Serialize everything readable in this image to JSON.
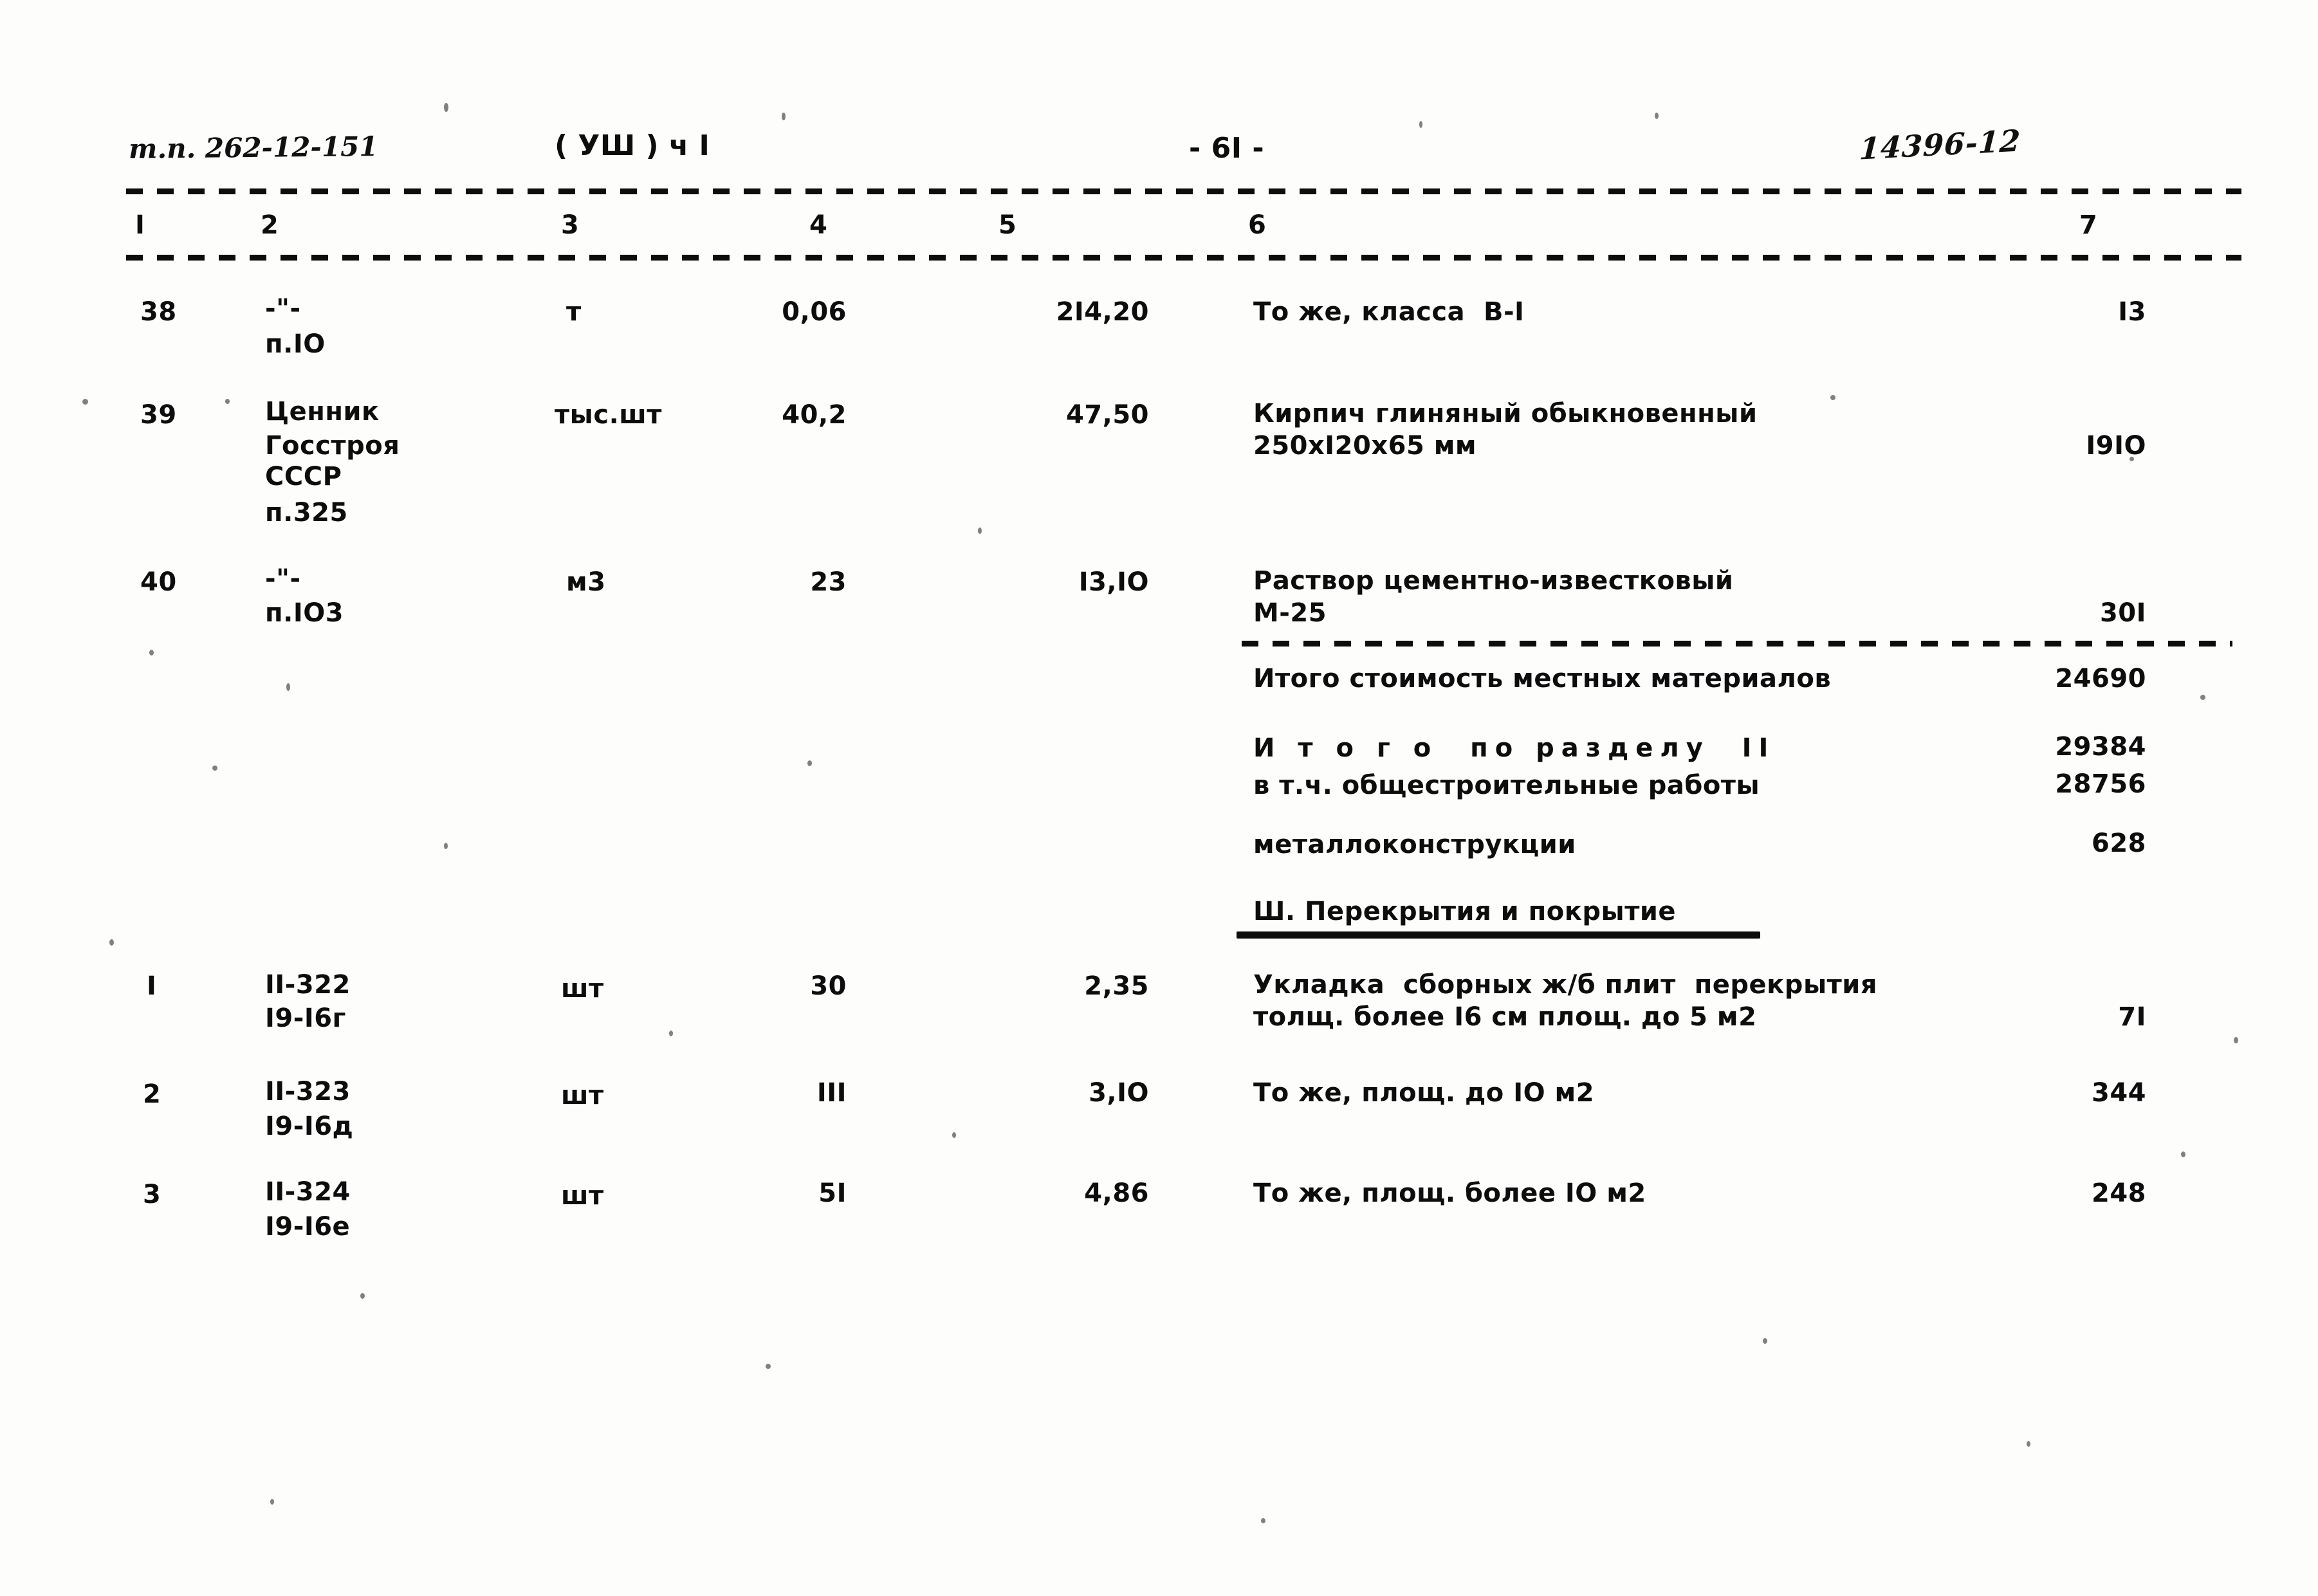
{
  "header": {
    "doc_code": "т.п. 262-12-151",
    "volume": "( УШ ) ч I",
    "page_number": "- 6I -",
    "archive_mark": "14396-12"
  },
  "table": {
    "column_headers": [
      "I",
      "2",
      "3",
      "4",
      "5",
      "6",
      "7"
    ],
    "rows": [
      {
        "no": "38",
        "code_line1": "-\"-",
        "code_line2": "п.IO",
        "unit": "т",
        "qty": "0,06",
        "price": "2I4,20",
        "desc_line1": "То же, класса  В-I",
        "desc_line2": "",
        "total": "I3"
      },
      {
        "no": "39",
        "code_line1": "Ценник",
        "code_line2": "Госстроя",
        "code_line3": "СССР",
        "code_line4": "п.325",
        "unit": "тыс.шт",
        "qty": "40,2",
        "price": "47,50",
        "desc_line1": "Кирпич глиняный обыкновенный",
        "desc_line2": "250хI20х65 мм",
        "total": "I9IO"
      },
      {
        "no": "40",
        "code_line1": "-\"-",
        "code_line2": "п.IO3",
        "unit": "м3",
        "qty": "23",
        "price": "I3,IO",
        "desc_line1": "Раствор цементно-известковый",
        "desc_line2": "М-25",
        "total": "30I"
      }
    ],
    "summary": [
      {
        "label": "Итого стоимость местных материалов",
        "value": "24690"
      },
      {
        "label": "И т о г о  по разделу  II",
        "value": "29384",
        "spaced": true
      },
      {
        "label": "в т.ч. общестроительные работы",
        "value": "28756"
      },
      {
        "label": "металлоконструкции",
        "value": "628"
      }
    ],
    "section_heading": "Ш. Перекрытия и покрытие",
    "section_rows": [
      {
        "no": "I",
        "code_line1": "II-322",
        "code_line2": "I9-I6г",
        "unit": "шт",
        "qty": "30",
        "price": "2,35",
        "desc_line1": "Укладка  сборных ж/б плит  перекрытия",
        "desc_line2": "толщ. более I6 см площ. до 5 м2",
        "total": "7I"
      },
      {
        "no": "2",
        "code_line1": "II-323",
        "code_line2": "I9-I6д",
        "unit": "шт",
        "qty": "III",
        "price": "3,IO",
        "desc_line1": "То же, площ. до IO м2",
        "desc_line2": "",
        "total": "344"
      },
      {
        "no": "3",
        "code_line1": "II-324",
        "code_line2": "I9-I6е",
        "unit": "шт",
        "qty": "5I",
        "price": "4,86",
        "desc_line1": "То же, площ. более IO м2",
        "desc_line2": "",
        "total": "248"
      }
    ]
  }
}
